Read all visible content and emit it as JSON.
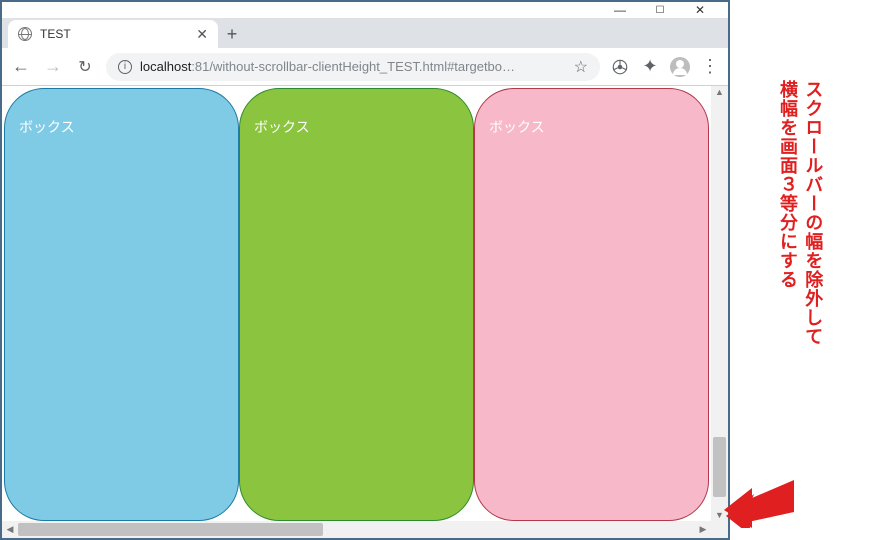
{
  "window": {
    "minimize": "—",
    "maximize": "☐",
    "close": "✕"
  },
  "tab": {
    "title": "TEST",
    "close": "✕",
    "newtab": "+"
  },
  "nav": {
    "back": "←",
    "forward": "→",
    "reload": "↻"
  },
  "omnibox": {
    "info": "i",
    "host": "localhost",
    "rest": ":81/without-scrollbar-clientHeight_TEST.html#targetbo…",
    "star": "☆"
  },
  "menu": {
    "dots": "⋮",
    "puzzle": "✦"
  },
  "boxes": [
    {
      "label": "ボックス",
      "color": "blue"
    },
    {
      "label": "ボックス",
      "color": "green"
    },
    {
      "label": "ボックス",
      "color": "pink"
    }
  ],
  "annotation": {
    "line1": "スクロールバーの幅を除外して",
    "line2": "横幅を画面３等分にする"
  },
  "colors": {
    "annotation_red": "#e02020",
    "blue_fill": "#7fcbe6",
    "green_fill": "#8bc53f",
    "pink_fill": "#f7b9ca"
  }
}
